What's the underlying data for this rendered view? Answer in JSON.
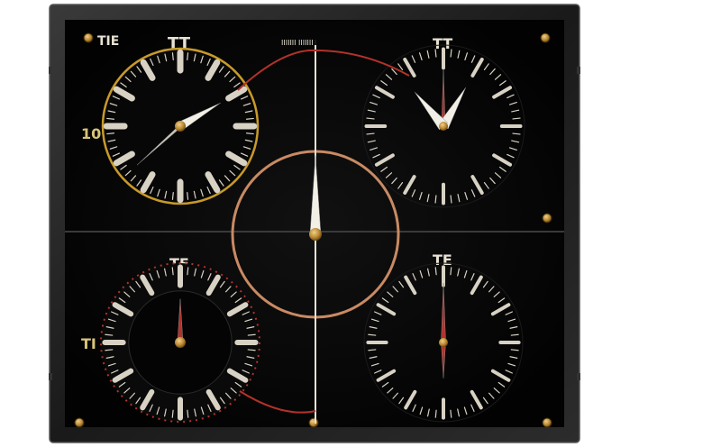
{
  "panel": {
    "labels": {
      "top_left": "TIE",
      "top_center_marks": "TT",
      "top_caption": "IIIIIII IIIIIII",
      "top_right_marks": "TT",
      "left_side": "10",
      "dial_a_center": "TT",
      "dial_a_lower": "TT",
      "dial_c_top": "TE",
      "dial_d_top": "TE",
      "dial_c_side": "TI"
    },
    "colors": {
      "frame": "#1e1e1e",
      "face": "#050505",
      "gold": "#c89a2a",
      "copper": "#c98a63",
      "red": "#b3322a",
      "tick": "#d8d2c4",
      "screw": "#b8862f"
    },
    "dials": [
      {
        "name": "dial-top-left",
        "ring": "gold",
        "hands": "hour-minute"
      },
      {
        "name": "dial-top-right",
        "ring": "none",
        "hands": "hour-minute"
      },
      {
        "name": "dial-center",
        "ring": "copper",
        "hands": "single-vertical"
      },
      {
        "name": "dial-bottom-left",
        "ring": "red-dotted",
        "hands": "single-vertical"
      },
      {
        "name": "dial-bottom-right",
        "ring": "none",
        "hands": "single-vertical"
      }
    ]
  }
}
